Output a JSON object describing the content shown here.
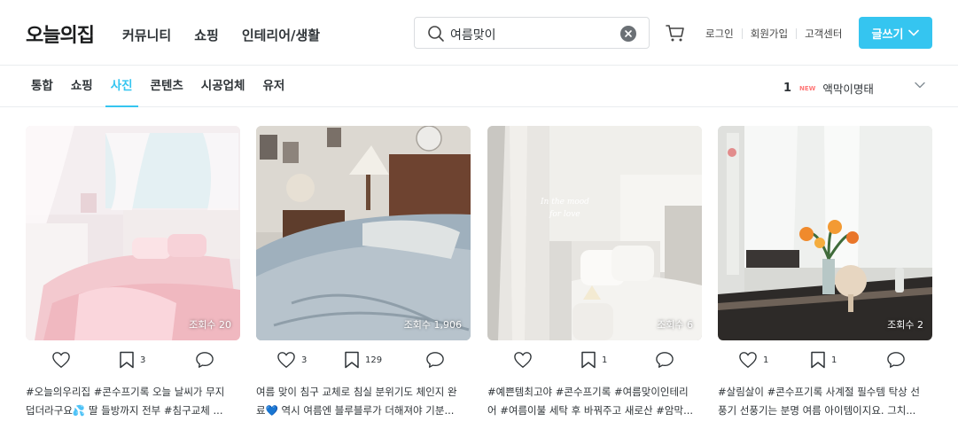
{
  "header": {
    "logo": "오늘의집",
    "nav": [
      "커뮤니티",
      "쇼핑",
      "인테리어/생활"
    ],
    "search_value": "여름맞이",
    "links": [
      "로그인",
      "회원가입",
      "고객센터"
    ],
    "write_label": "글쓰기"
  },
  "subnav": {
    "tabs": [
      "통합",
      "쇼핑",
      "사진",
      "콘텐츠",
      "시공업체",
      "유저"
    ],
    "active_tab": "사진",
    "rank_number": "1",
    "rank_badge": "NEW",
    "rank_keyword": "액막이명태"
  },
  "cards": [
    {
      "views": "조회수 20",
      "likes": "",
      "scraps": "3",
      "comments": "",
      "caption_line1": "#오늘의우리집 #콘수프기록 오늘 날씨가 무지",
      "caption_line2": "덥더라구요💦 딸 들방까지 전부 #침구교체 ..."
    },
    {
      "views": "조회수 1,906",
      "likes": "3",
      "scraps": "129",
      "comments": "",
      "caption_line1": "여름 맞이 침구 교체로 침실 분위기도 체인지 완",
      "caption_line2": "료💙 역시 여름엔 블루블루가 더해져야 기분..."
    },
    {
      "views": "조회수 6",
      "likes": "",
      "scraps": "1",
      "comments": "",
      "caption_line1": "#예쁜템최고야 #콘수프기록 #여름맞이인테리",
      "caption_line2": "어 #여름이불 세탁 후 바꿔주고 새로산 #암막..."
    },
    {
      "views": "조회수 2",
      "likes": "1",
      "scraps": "1",
      "comments": "",
      "caption_line1": "#살림살이 #콘수프기록 사계절 필수템 탁상 선",
      "caption_line2": "풍기 선풍기는 분명 여름 아이템이지요. 그치..."
    }
  ],
  "colors": {
    "accent": "#35c5f0",
    "new_badge": "#ff7777",
    "text": "#2f3438"
  }
}
